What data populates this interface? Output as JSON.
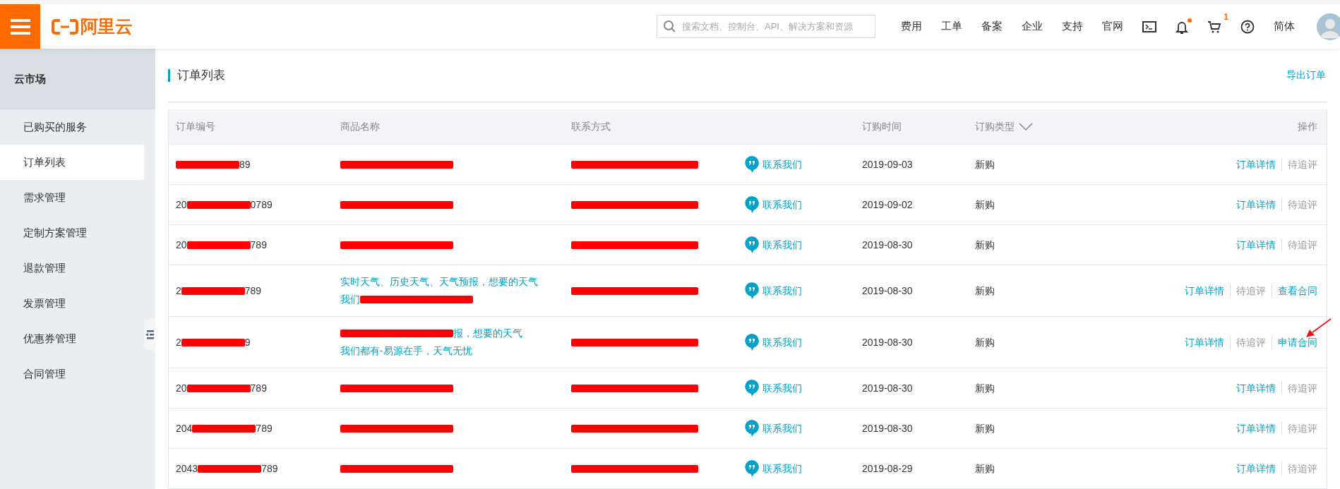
{
  "topbar": {
    "logo": "阿里云",
    "search": {
      "placeholder": "搜索文档、控制台、API、解决方案和资源"
    },
    "nav": [
      "费用",
      "工单",
      "备案",
      "企业",
      "支持",
      "官网"
    ],
    "cart_count": "1",
    "bell_dot": true,
    "language": "简体"
  },
  "sidebar": {
    "title": "云市场",
    "items": [
      {
        "label": "已购买的服务",
        "selected": false
      },
      {
        "label": "订单列表",
        "selected": true
      },
      {
        "label": "需求管理",
        "selected": false
      },
      {
        "label": "定制方案管理",
        "selected": false
      },
      {
        "label": "退款管理",
        "selected": false
      },
      {
        "label": "发票管理",
        "selected": false
      },
      {
        "label": "优惠券管理",
        "selected": false
      },
      {
        "label": "合同管理",
        "selected": false
      }
    ]
  },
  "page": {
    "title": "订单列表",
    "export": "导出订单"
  },
  "table": {
    "columns": [
      "订单编号",
      "商品名称",
      "联系方式",
      "订购时间",
      "订购类型",
      "操作"
    ],
    "rows": [
      {
        "order_no": [
          {
            "kind": "redaction"
          },
          {
            "kind": "text",
            "text": "89"
          }
        ],
        "product": [
          [
            {
              "kind": "redaction"
            }
          ]
        ],
        "contact": [
          {
            "kind": "redaction"
          }
        ],
        "contact_us": "联系我们",
        "date": "2019-09-03",
        "type": "新购",
        "actions": [
          {
            "kind": "link",
            "text": "订单详情"
          },
          {
            "kind": "muted",
            "text": "待追评"
          }
        ],
        "marked": false
      },
      {
        "order_no": [
          {
            "kind": "text",
            "text": "20"
          },
          {
            "kind": "redaction"
          },
          {
            "kind": "text",
            "text": "0789"
          }
        ],
        "product": [
          [
            {
              "kind": "redaction"
            }
          ]
        ],
        "contact": [
          {
            "kind": "redaction"
          }
        ],
        "contact_us": "联系我们",
        "date": "2019-09-02",
        "type": "新购",
        "actions": [
          {
            "kind": "link",
            "text": "订单详情"
          },
          {
            "kind": "muted",
            "text": "待追评"
          }
        ],
        "marked": false
      },
      {
        "order_no": [
          {
            "kind": "text",
            "text": "20"
          },
          {
            "kind": "redaction"
          },
          {
            "kind": "text",
            "text": "789"
          }
        ],
        "product": [
          [
            {
              "kind": "redaction"
            }
          ]
        ],
        "contact": [
          {
            "kind": "redaction"
          }
        ],
        "contact_us": "联系我们",
        "date": "2019-08-30",
        "type": "新购",
        "actions": [
          {
            "kind": "link",
            "text": "订单详情"
          },
          {
            "kind": "muted",
            "text": "待追评"
          }
        ],
        "marked": false
      },
      {
        "order_no": [
          {
            "kind": "text",
            "text": "2"
          },
          {
            "kind": "redaction"
          },
          {
            "kind": "text",
            "text": "789"
          }
        ],
        "product": [
          [
            {
              "kind": "text",
              "text": "实时天气、历史天气、天气预报，想要的天气"
            }
          ],
          [
            {
              "kind": "text",
              "text": "我们"
            },
            {
              "kind": "redaction"
            }
          ]
        ],
        "contact": [
          {
            "kind": "redaction"
          }
        ],
        "contact_us": "联系我们",
        "date": "2019-08-30",
        "type": "新购",
        "actions": [
          {
            "kind": "link",
            "text": "订单详情"
          },
          {
            "kind": "muted",
            "text": "待追评"
          },
          {
            "kind": "link",
            "text": "查看合同"
          }
        ],
        "marked": false
      },
      {
        "order_no": [
          {
            "kind": "text",
            "text": "2"
          },
          {
            "kind": "redaction"
          },
          {
            "kind": "text",
            "text": "9"
          }
        ],
        "product": [
          [
            {
              "kind": "redaction"
            },
            {
              "kind": "text",
              "text": "报，想要的天气"
            }
          ],
          [
            {
              "kind": "text",
              "text": "我们都有-易源在手，天气无忧"
            }
          ]
        ],
        "contact": [
          {
            "kind": "redaction"
          }
        ],
        "contact_us": "联系我们",
        "date": "2019-08-30",
        "type": "新购",
        "actions": [
          {
            "kind": "link",
            "text": "订单详情"
          },
          {
            "kind": "muted",
            "text": "待追评"
          },
          {
            "kind": "link",
            "text": "申请合同"
          }
        ],
        "marked": true
      },
      {
        "order_no": [
          {
            "kind": "text",
            "text": "20"
          },
          {
            "kind": "redaction"
          },
          {
            "kind": "text",
            "text": "789"
          }
        ],
        "product": [
          [
            {
              "kind": "redaction"
            }
          ]
        ],
        "contact": [
          {
            "kind": "redaction"
          }
        ],
        "contact_us": "联系我们",
        "date": "2019-08-30",
        "type": "新购",
        "actions": [
          {
            "kind": "link",
            "text": "订单详情"
          },
          {
            "kind": "muted",
            "text": "待追评"
          }
        ],
        "marked": false
      },
      {
        "order_no": [
          {
            "kind": "text",
            "text": "204"
          },
          {
            "kind": "redaction"
          },
          {
            "kind": "text",
            "text": "789"
          }
        ],
        "product": [
          [
            {
              "kind": "redaction"
            }
          ]
        ],
        "contact": [
          {
            "kind": "redaction"
          }
        ],
        "contact_us": "联系我们",
        "date": "2019-08-30",
        "type": "新购",
        "actions": [
          {
            "kind": "link",
            "text": "订单详情"
          },
          {
            "kind": "muted",
            "text": "待追评"
          }
        ],
        "marked": false
      },
      {
        "order_no": [
          {
            "kind": "text",
            "text": "2043"
          },
          {
            "kind": "redaction"
          },
          {
            "kind": "text",
            "text": "789"
          }
        ],
        "product": [
          [
            {
              "kind": "redaction"
            }
          ]
        ],
        "contact": [
          {
            "kind": "redaction"
          }
        ],
        "contact_us": "联系我们",
        "date": "2019-08-29",
        "type": "新购",
        "actions": [
          {
            "kind": "link",
            "text": "订单详情"
          },
          {
            "kind": "muted",
            "text": "待追评"
          }
        ],
        "marked": false
      }
    ]
  }
}
